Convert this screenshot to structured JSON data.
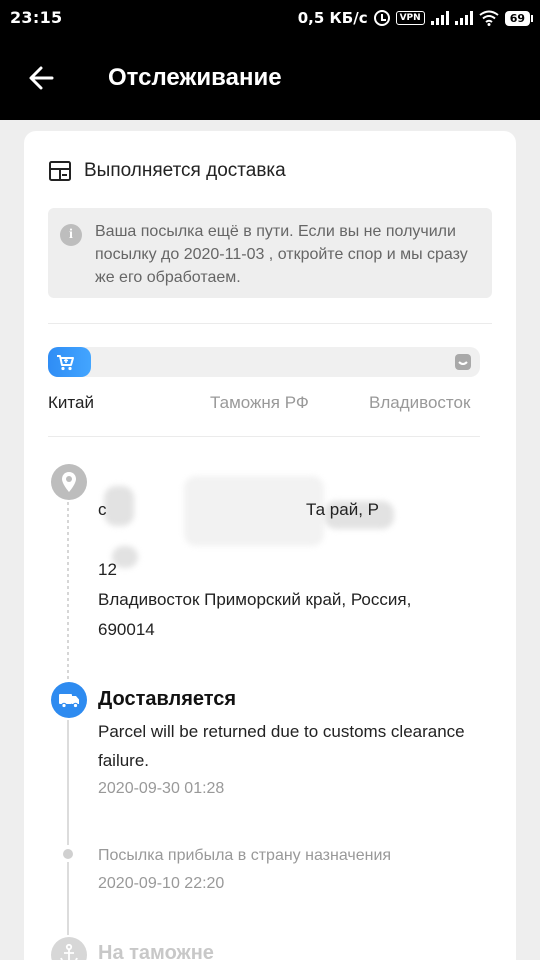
{
  "status_bar": {
    "time": "23:15",
    "net_speed": "0,5 КБ/с",
    "vpn": "VPN",
    "battery": "69",
    "icons": [
      "alarm-clock-icon",
      "vpn-icon",
      "signal-icon",
      "signal-icon",
      "wifi-icon",
      "battery-icon"
    ]
  },
  "header": {
    "back_icon": "arrow-left-icon",
    "title": "Отслеживание"
  },
  "status": {
    "icon": "box-icon",
    "title": "Выполняется доставка"
  },
  "notice": {
    "icon": "info-icon",
    "text": "Ваша посылка ещё в пути. Если вы не получили посылку до 2020-11-03 , откройте спор и мы сразу же его обработаем."
  },
  "progress": {
    "fraction": 0.1,
    "start_icon": "cart-icon",
    "end_icon": "package-icon",
    "colors": {
      "fill": "#2f8df5",
      "track": "#f0f0f0"
    }
  },
  "route": {
    "from": "Китай",
    "mid": "Таможня РФ",
    "to": "Владивосток"
  },
  "address": {
    "icon": "location-pin-icon",
    "line1_start": "с",
    "line1_end": "Та              рай, Р",
    "line2": "12",
    "line3": "Владивосток Приморский край, Россия,",
    "line4": "690014"
  },
  "events": [
    {
      "icon": "truck-icon",
      "title": "Доставляется",
      "desc": "Parcel will be returned due to customs clearance failure.",
      "time": "2020-09-30 01:28"
    },
    {
      "title": "Посылка прибыла в страну назначения",
      "time": "2020-09-10 22:20"
    },
    {
      "icon": "anchor-icon",
      "title": "На таможне"
    }
  ]
}
